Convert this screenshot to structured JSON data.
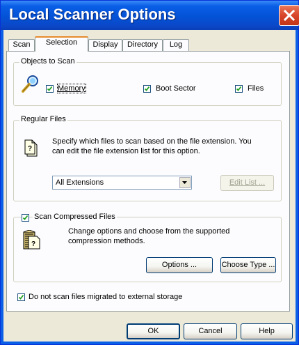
{
  "window": {
    "title": "Local Scanner Options"
  },
  "icons": {
    "close": "close-icon",
    "magnifier": "magnifier-icon",
    "file": "file-icon",
    "compress": "compressed-file-icon",
    "check": "checkmark-icon",
    "dropdown": "dropdown-arrow-icon"
  },
  "tabs": [
    {
      "label": "Scan"
    },
    {
      "label": "Selection",
      "active": true
    },
    {
      "label": "Display"
    },
    {
      "label": "Directory"
    },
    {
      "label": "Log"
    }
  ],
  "objects_to_scan": {
    "title": "Objects to Scan",
    "memory": {
      "label": "Memory",
      "checked": true
    },
    "boot_sector": {
      "label": "Boot Sector",
      "checked": true
    },
    "files": {
      "label": "Files",
      "checked": true
    }
  },
  "regular_files": {
    "title": "Regular Files",
    "desc_line1": "Specify which files to scan based on the file extension. You",
    "desc_line2": "can edit the file extension list for this option.",
    "extensions_value": "All Extensions",
    "edit_list_label": "Edit List ..."
  },
  "compressed": {
    "title": "Scan Compressed Files",
    "checked": true,
    "desc_line1": "Change options and choose from the supported",
    "desc_line2": "compression methods.",
    "options_label": "Options ...",
    "choose_type_label": "Choose Type ..."
  },
  "migrated": {
    "label": "Do not scan files migrated to external storage",
    "checked": true
  },
  "footer": {
    "ok_label": "OK",
    "cancel_label": "Cancel",
    "help_label": "Help"
  },
  "colors": {
    "titlebar": "#0a5fe6",
    "close": "#d8452a",
    "dialog_bg": "#ece9d8",
    "panel_bg": "#fcfcfe",
    "tab_highlight": "#e68b2c"
  }
}
